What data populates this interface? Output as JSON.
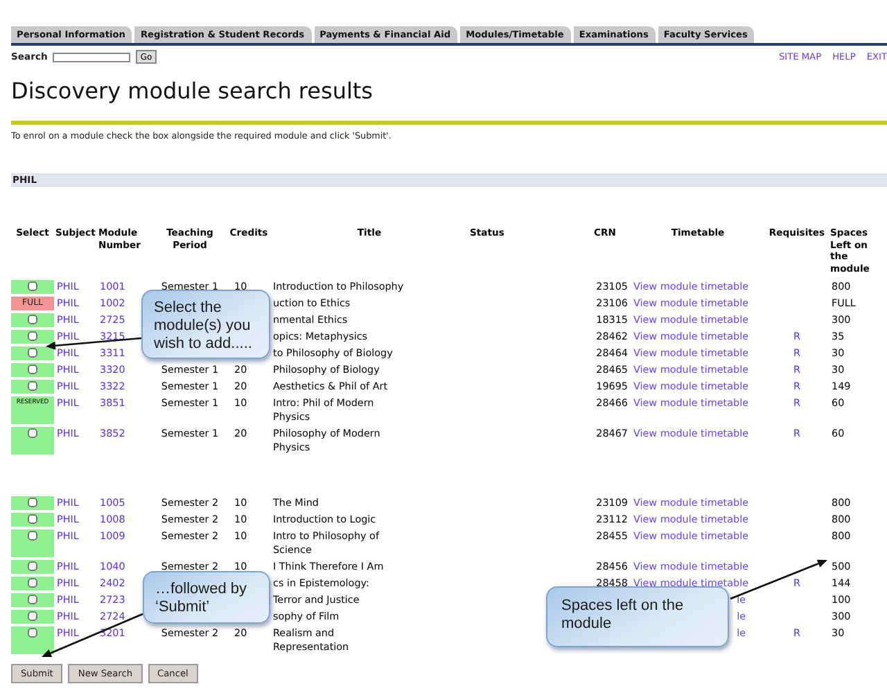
{
  "tabs": [
    {
      "label": "Personal Information"
    },
    {
      "label": "Registration & Student Records"
    },
    {
      "label": "Payments & Financial Aid"
    },
    {
      "label": "Modules/Timetable"
    },
    {
      "label": "Examinations"
    },
    {
      "label": "Faculty Services"
    }
  ],
  "search": {
    "label": "Search",
    "button": "Go"
  },
  "top_links": [
    "SITE MAP",
    "HELP",
    "EXIT"
  ],
  "page_title": "Discovery module search results",
  "instruction": "To enrol on a module check the box alongside the required module and click 'Submit'.",
  "subject_band": "PHIL",
  "table": {
    "columns": [
      "Select",
      "Subject",
      "Module Number",
      "Teaching Period",
      "Credits",
      "Title",
      "Status",
      "CRN",
      "Timetable",
      "Requisites",
      "Spaces Left on the module"
    ],
    "groups": [
      {
        "rows": [
          {
            "select": {
              "kind": "checkbox",
              "checked": false
            },
            "subject": "PHIL",
            "module": "1001",
            "period": "Semester 1",
            "credits": "10",
            "title": "Introduction to Philosophy",
            "crn": "23105",
            "timetable": "View module timetable",
            "spaces": "800"
          },
          {
            "select": {
              "kind": "full",
              "label": "FULL"
            },
            "subject": "PHIL",
            "module": "1002",
            "title": "uction to Ethics",
            "crn": "23106",
            "timetable": "View module timetable",
            "spaces": "FULL"
          },
          {
            "select": {
              "kind": "checkbox",
              "checked": false
            },
            "subject": "PHIL",
            "module": "2725",
            "title": "nmental Ethics",
            "crn": "18315",
            "timetable": "View module timetable",
            "spaces": "300"
          },
          {
            "select": {
              "kind": "checkbox",
              "checked": false
            },
            "subject": "PHIL",
            "module": "3215",
            "title": "opics: Metaphysics",
            "crn": "28462",
            "timetable": "View module timetable",
            "requisites": "R",
            "spaces": "35"
          },
          {
            "select": {
              "kind": "checkbox",
              "checked": false
            },
            "subject": "PHIL",
            "module": "3311",
            "title": "to Philosophy of Biology",
            "crn": "28464",
            "timetable": "View module timetable",
            "requisites": "R",
            "spaces": "30"
          },
          {
            "select": {
              "kind": "checkbox",
              "checked": false
            },
            "subject": "PHIL",
            "module": "3320",
            "period": "Semester 1",
            "credits": "20",
            "title": "Philosophy of Biology",
            "crn": "28465",
            "timetable": "View module timetable",
            "requisites": "R",
            "spaces": "30"
          },
          {
            "select": {
              "kind": "checkbox",
              "checked": false
            },
            "subject": "PHIL",
            "module": "3322",
            "period": "Semester 1",
            "credits": "20",
            "title": "Aesthetics & Phil of Art",
            "crn": "19695",
            "timetable": "View module timetable",
            "requisites": "R",
            "spaces": "149"
          },
          {
            "select": {
              "kind": "reserved",
              "label": "RESERVED"
            },
            "subject": "PHIL",
            "module": "3851",
            "period": "Semester 1",
            "credits": "10",
            "title": "Intro: Phil of Modern Physics",
            "crn": "28466",
            "timetable": "View module timetable",
            "requisites": "R",
            "spaces": "60"
          },
          {
            "select": {
              "kind": "checkbox",
              "checked": false
            },
            "subject": "PHIL",
            "module": "3852",
            "period": "Semester 1",
            "credits": "20",
            "title": "Philosophy of Modern Physics",
            "crn": "28467",
            "timetable": "View module timetable",
            "requisites": "R",
            "spaces": "60"
          }
        ]
      },
      {
        "rows": [
          {
            "select": {
              "kind": "checkbox",
              "checked": false
            },
            "subject": "PHIL",
            "module": "1005",
            "period": "Semester 2",
            "credits": "10",
            "title": "The Mind",
            "crn": "23109",
            "timetable": "View module timetable",
            "spaces": "800"
          },
          {
            "select": {
              "kind": "checkbox",
              "checked": false
            },
            "subject": "PHIL",
            "module": "1008",
            "period": "Semester 2",
            "credits": "10",
            "title": "Introduction to Logic",
            "crn": "23112",
            "timetable": "View module timetable",
            "spaces": "800"
          },
          {
            "select": {
              "kind": "checkbox",
              "checked": false
            },
            "subject": "PHIL",
            "module": "1009",
            "period": "Semester 2",
            "credits": "10",
            "title": "Intro to Philosophy of Science",
            "crn": "28455",
            "timetable": "View module timetable",
            "spaces": "800"
          },
          {
            "select": {
              "kind": "checkbox",
              "checked": false
            },
            "subject": "PHIL",
            "module": "1040",
            "period": "Semester 2",
            "credits": "10",
            "title": "I Think Therefore I Am",
            "crn": "28456",
            "timetable": "View module timetable",
            "spaces": "500"
          },
          {
            "select": {
              "kind": "checkbox",
              "checked": false
            },
            "subject": "PHIL",
            "module": "2402",
            "title": "cs in Epistemology:",
            "crn": "28458",
            "timetable": "View module timetable",
            "requisites": "R",
            "spaces": "144"
          },
          {
            "select": {
              "kind": "checkbox",
              "checked": false
            },
            "subject": "PHIL",
            "module": "2723",
            "title": "Terror and Justice",
            "timetable": "le",
            "spaces": "100"
          },
          {
            "select": {
              "kind": "checkbox",
              "checked": false
            },
            "subject": "PHIL",
            "module": "2724",
            "title": "sophy of Film",
            "timetable": "le",
            "spaces": "300"
          },
          {
            "select": {
              "kind": "checkbox",
              "checked": false
            },
            "subject": "PHIL",
            "module": "3201",
            "period": "Semester 2",
            "credits": "20",
            "title": "Realism and Representation",
            "timetable": "le",
            "requisites": "R",
            "spaces": "30"
          }
        ]
      }
    ]
  },
  "buttons": [
    "Submit",
    "New Search",
    "Cancel"
  ],
  "callouts": [
    "Select the module(s) you wish to add.....",
    "…followed by ‘Submit’",
    "Spaces left on the module"
  ]
}
